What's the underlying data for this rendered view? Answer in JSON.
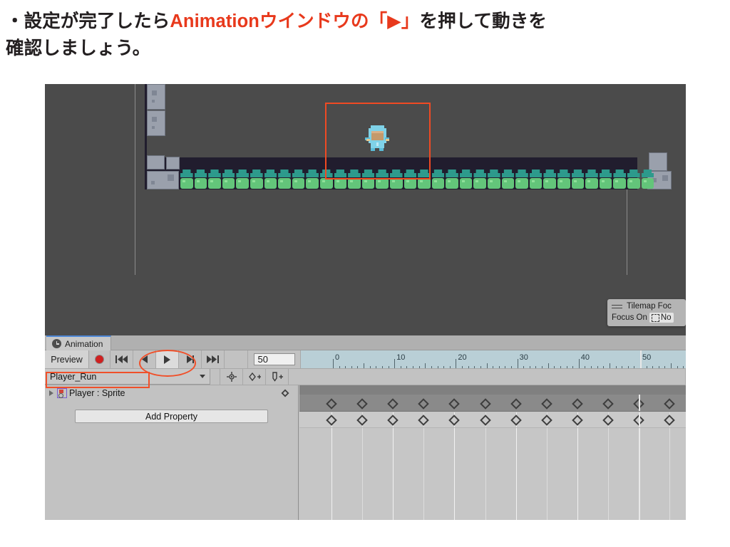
{
  "caption": {
    "line1_pre": "・設定が完了したら",
    "line1_hl": "Animationウインドウの「▶」",
    "line1_post": "を押して動きを",
    "line2": "確認しましょう。",
    "highlight_color": "#e8391c"
  },
  "scene": {
    "background_color": "#4b4b4b",
    "level_background_color": "#211d2e",
    "grass_tile_color": "#63c57a",
    "grass_top_color": "#2d9a8c",
    "stone_color": "#9aa0ac",
    "selection_rect_color": "#f0502a",
    "player_name": "Player",
    "grass_tile_count": 35
  },
  "overlay": {
    "title": "Tilemap Foc",
    "focus_label": "Focus On",
    "focus_value": "No",
    "grip_icon": "drag-handle-icon"
  },
  "animation_window": {
    "tab_label": "Animation",
    "tab_icon": "clock-icon",
    "accent_color": "#4d87d6",
    "toolbar": {
      "preview_label": "Preview",
      "record_icon": "record-icon",
      "first_frame_icon": "skip-to-start-icon",
      "prev_frame_icon": "step-back-icon",
      "play_icon": "play-icon",
      "next_frame_icon": "step-forward-icon",
      "last_frame_icon": "skip-to-end-icon",
      "frame_value": "50",
      "frame_placeholder": "0"
    },
    "clipbar": {
      "clip_name": "Player_Run",
      "dropdown_icon": "chevron-down-icon",
      "filter_icon": "target-filter-icon",
      "add_keyframe_icon": "add-keyframe-icon",
      "add_event_icon": "add-event-icon"
    },
    "hierarchy": {
      "expand_icon": "expand-triangle-icon",
      "property_icon": "sprite-renderer-icon",
      "property_label": "Player : Sprite",
      "keyframe_icon": "keyframe-diamond-icon",
      "add_property_label": "Add Property"
    },
    "timeline": {
      "ruler_labels": [
        "0",
        "10",
        "20",
        "30",
        "40",
        "50"
      ],
      "ruler_values": [
        0,
        10,
        20,
        30,
        40,
        50
      ],
      "playhead_frame": 50,
      "keyframe_frames": [
        0,
        5,
        10,
        15,
        20,
        25,
        30,
        35,
        40,
        45,
        50,
        55
      ],
      "frames_per_pixel_label": "8.6",
      "ruler_background": "#b9cfd6"
    }
  },
  "annotations": {
    "play_button_ellipse": "red-ellipse-highlight",
    "clip_name_rect": "red-rect-highlight",
    "color": "#f0502a"
  }
}
